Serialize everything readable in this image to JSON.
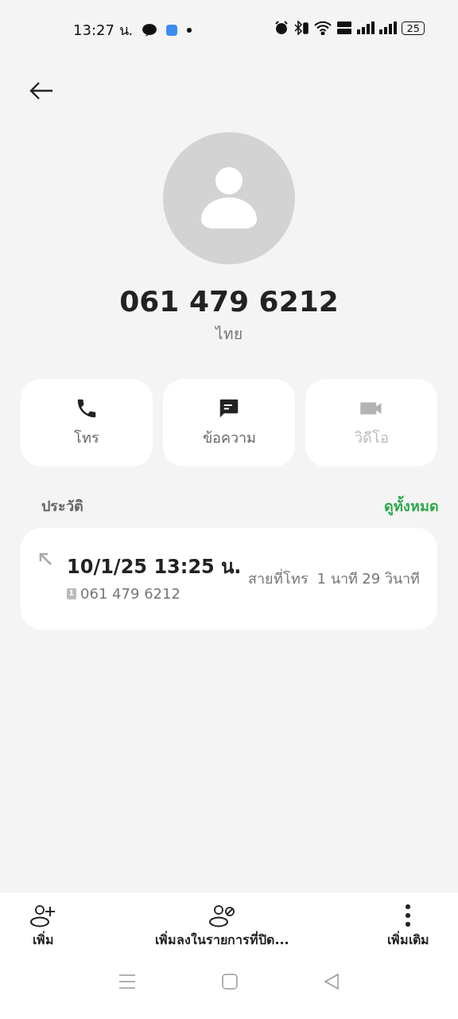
{
  "status_bar": {
    "time": "13:27 น.",
    "battery": "25"
  },
  "contact": {
    "name": "061 479 6212",
    "label": "ไทย"
  },
  "actions": [
    {
      "kind": "call",
      "label": "โทร",
      "disabled": false
    },
    {
      "kind": "message",
      "label": "ข้อความ",
      "disabled": false
    },
    {
      "kind": "video",
      "label": "วิดีโอ",
      "disabled": true
    }
  ],
  "history": {
    "title": "ประวัติ",
    "view_all": "ดูทั้งหมด",
    "entries": [
      {
        "datetime": "10/1/25 13:25 น.",
        "sim": "1",
        "number": "061 479 6212",
        "type": "สายที่โทร",
        "duration": "1 นาที 29 วินาที"
      }
    ]
  },
  "bottom_bar": [
    {
      "kind": "add",
      "label": "เพิ่ม"
    },
    {
      "kind": "block",
      "label": "เพิ่มลงในรายการที่ปิด..."
    },
    {
      "kind": "more",
      "label": "เพิ่มเติม"
    }
  ]
}
